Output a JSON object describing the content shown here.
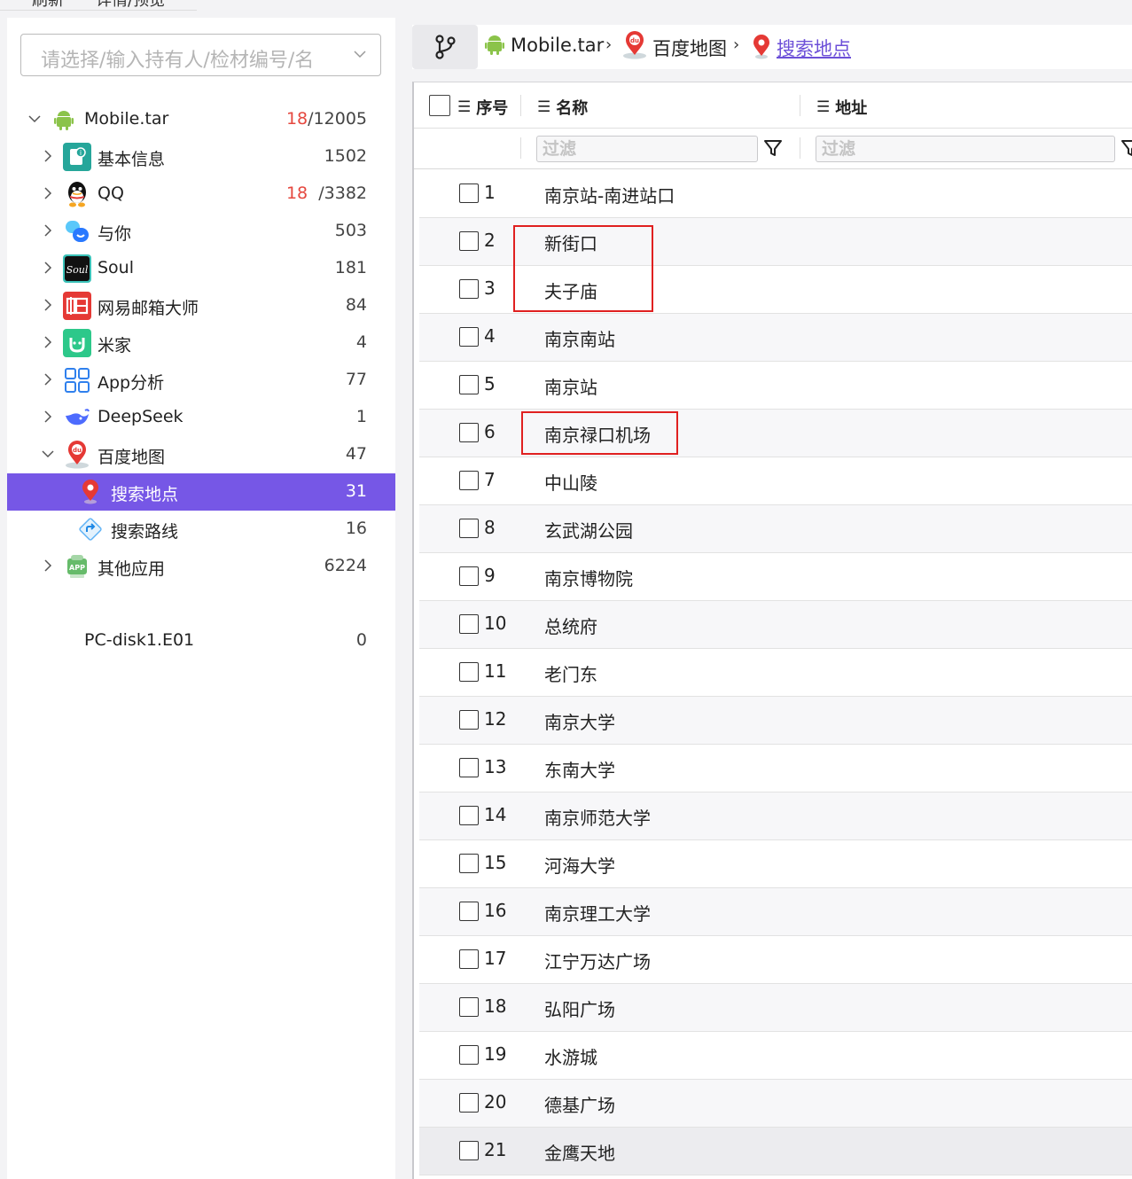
{
  "toolbar": {
    "refresh_label": "刷新",
    "detail_label": "详情/预览"
  },
  "search": {
    "placeholder": "请选择/输入持有人/检材编号/名"
  },
  "tree": {
    "root": {
      "label": "Mobile.tar",
      "count_hit": "18",
      "count_total": "/12005"
    },
    "items": [
      {
        "label": "基本信息",
        "count": "1502",
        "icon": "info-icon"
      },
      {
        "label": "QQ",
        "count_hit": "18",
        "count_total": "/3382",
        "icon": "qq-icon"
      },
      {
        "label": "与你",
        "count": "503",
        "icon": "yuni-icon"
      },
      {
        "label": "Soul",
        "count": "181",
        "icon": "soul-icon"
      },
      {
        "label": "网易邮箱大师",
        "count": "84",
        "icon": "mail-master-icon"
      },
      {
        "label": "米家",
        "count": "4",
        "icon": "mijia-icon"
      },
      {
        "label": "App分析",
        "count": "77",
        "icon": "app-analysis-icon"
      },
      {
        "label": "DeepSeek",
        "count": "1",
        "icon": "deepseek-icon"
      },
      {
        "label": "百度地图",
        "count": "47",
        "icon": "baidu-map-icon"
      }
    ],
    "sub_items": [
      {
        "label": "搜索地点",
        "count": "31",
        "icon": "location-pin-icon"
      },
      {
        "label": "搜索路线",
        "count": "16",
        "icon": "route-icon"
      }
    ],
    "other": {
      "label": "其他应用",
      "count": "6224",
      "icon": "app-icon"
    },
    "disk": {
      "label": "PC-disk1.E01",
      "count": "0"
    }
  },
  "breadcrumb": {
    "root": "Mobile.tar",
    "app": "百度地图",
    "current": "搜索地点"
  },
  "table": {
    "columns": {
      "index": "序号",
      "name": "名称",
      "address": "地址"
    },
    "filter_placeholder": "过滤",
    "rows": [
      {
        "num": "1",
        "name": "南京站-南进站口"
      },
      {
        "num": "2",
        "name": "新街口"
      },
      {
        "num": "3",
        "name": "夫子庙"
      },
      {
        "num": "4",
        "name": "南京南站"
      },
      {
        "num": "5",
        "name": "南京站"
      },
      {
        "num": "6",
        "name": "南京禄口机场"
      },
      {
        "num": "7",
        "name": "中山陵"
      },
      {
        "num": "8",
        "name": "玄武湖公园"
      },
      {
        "num": "9",
        "name": "南京博物院"
      },
      {
        "num": "10",
        "name": "总统府"
      },
      {
        "num": "11",
        "name": "老门东"
      },
      {
        "num": "12",
        "name": "南京大学"
      },
      {
        "num": "13",
        "name": "东南大学"
      },
      {
        "num": "14",
        "name": "南京师范大学"
      },
      {
        "num": "15",
        "name": "河海大学"
      },
      {
        "num": "16",
        "name": "南京理工大学"
      },
      {
        "num": "17",
        "name": "江宁万达广场"
      },
      {
        "num": "18",
        "name": "弘阳广场"
      },
      {
        "num": "19",
        "name": "水游城"
      },
      {
        "num": "20",
        "name": "德基广场"
      },
      {
        "num": "21",
        "name": "金鹰天地"
      }
    ]
  },
  "colors": {
    "accent": "#7657e6",
    "hit_count": "#e5483f",
    "highlight_box": "#e02020"
  }
}
